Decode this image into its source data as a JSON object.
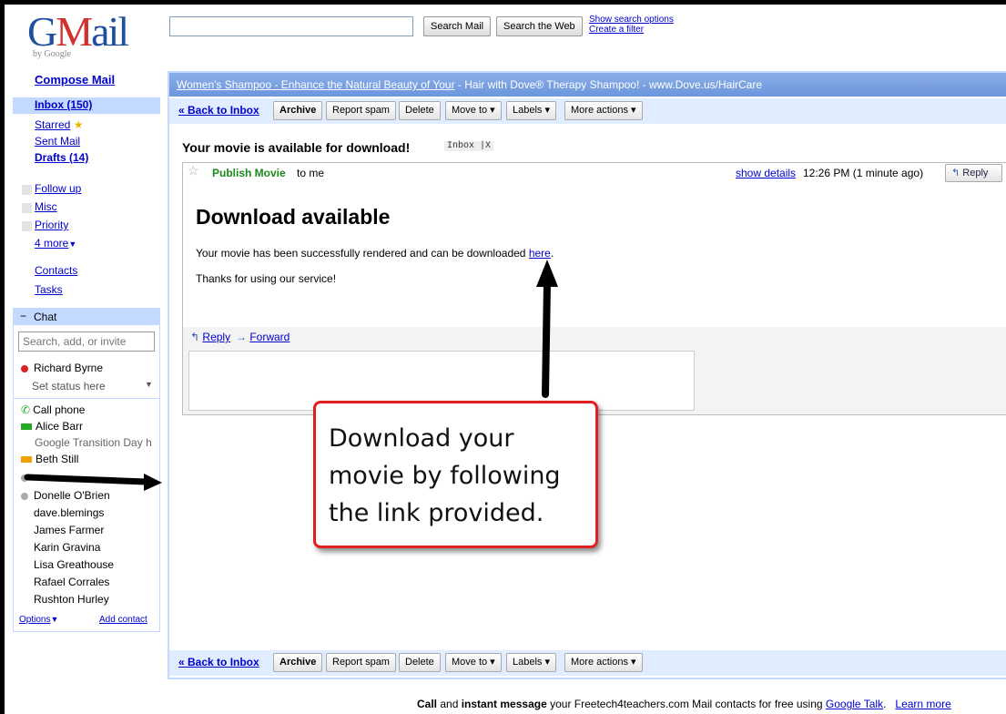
{
  "header": {
    "logo_text_g": "G",
    "logo_text_m": "M",
    "logo_text_ail": "ail",
    "logo_by": "by Google",
    "search_value": "",
    "search_mail_label": "Search Mail",
    "search_web_label": "Search the Web",
    "show_search_options": "Show search options",
    "create_filter": "Create a filter"
  },
  "sidebar": {
    "compose": "Compose Mail",
    "inbox": "Inbox (150)",
    "starred": "Starred",
    "sent": "Sent Mail",
    "drafts": "Drafts (14)",
    "labels": [
      {
        "name": "Follow up",
        "color": "#e0e0e0"
      },
      {
        "name": "Misc",
        "color": "#e0e0e0"
      },
      {
        "name": "Priority",
        "color": "#e0e0e0"
      }
    ],
    "more_labels": "4 more",
    "contacts": "Contacts",
    "tasks": "Tasks"
  },
  "chat": {
    "header": "Chat",
    "search_placeholder": "Search, add, or invite",
    "me_name": "Richard Byrne",
    "set_status": "Set status here",
    "call_phone": "Call phone",
    "contacts": [
      {
        "name": "Alice Barr",
        "status": "Google Transition Day h"
      },
      {
        "name": "Beth Still"
      },
      {
        "name": "Donelle O'Brien"
      },
      {
        "name": "dave.blemings"
      },
      {
        "name": "James Farmer"
      },
      {
        "name": "Karin Gravina"
      },
      {
        "name": "Lisa Greathouse"
      },
      {
        "name": "Rafael Corrales"
      },
      {
        "name": "Rushton Hurley"
      }
    ],
    "options": "Options",
    "add_contact": "Add contact"
  },
  "ad": {
    "link": "Women's Shampoo - Enhance the Natural Beauty of Your",
    "text": " - Hair with Dove® Therapy Shampoo! - www.Dove.us/HairCare"
  },
  "toolbar": {
    "back": "« Back to Inbox",
    "archive": "Archive",
    "spam": "Report spam",
    "delete": "Delete",
    "move": "Move to ▾",
    "labels": "Labels ▾",
    "more": "More actions ▾"
  },
  "message": {
    "subject": "Your movie is available for download!",
    "tag": "Inbox |X",
    "from": "Publish Movie",
    "to": "to me",
    "show_details": "show details",
    "time": "12:26 PM (1 minute ago)",
    "reply_btn": "Reply",
    "heading": "Download available",
    "body_before_link": "Your movie has been successfully rendered and can be downloaded ",
    "body_link": "here",
    "body_after_link": ".",
    "body2": "Thanks for using our service!",
    "reply_link": "Reply",
    "forward_link": "Forward"
  },
  "callout": {
    "line1": "Download your",
    "line2": "movie by following",
    "line3": "the link provided."
  },
  "footer": {
    "call": "Call",
    "and": " and ",
    "instant": "instant message",
    "rest": " your Freetech4teachers.com Mail contacts for free using ",
    "talk_link": "Google Talk",
    "learn_more": "Learn more"
  }
}
